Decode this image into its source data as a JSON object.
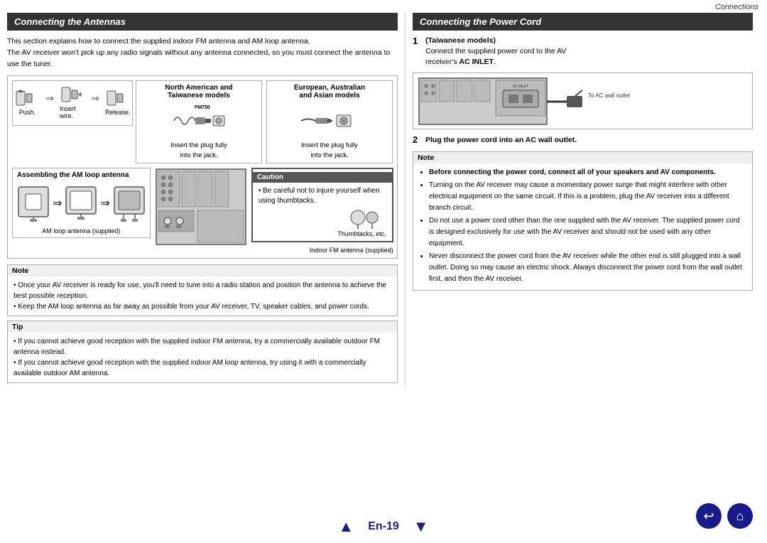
{
  "header": {
    "section_label": "Connections"
  },
  "left_section": {
    "title": "Connecting the Antennas",
    "intro_lines": [
      "This section explains how to connect the supplied indoor FM antenna and AM loop antenna.",
      "The AV receiver won't pick up any radio signals without any antenna connected, so you must connect the antenna to use the tuner."
    ],
    "fm_wire": {
      "steps": [
        "Push.",
        "Insert wire.",
        "Release."
      ]
    },
    "north_american_box": {
      "heading_line1": "North American and",
      "heading_line2": "Taiwanese models",
      "fm750_label": "FM750",
      "text_line1": "Insert the plug fully",
      "text_line2": "into the jack."
    },
    "european_box": {
      "heading_line1": "European, Australian",
      "heading_line2": "and Asian models",
      "text_line1": "Insert the plug fully",
      "text_line2": "into the jack."
    },
    "am_loop": {
      "header": "Assembling the AM loop antenna",
      "label": "AM loop antenna (supplied)"
    },
    "caution": {
      "header": "Caution",
      "bullet": "Be careful not to injure yourself when using thumbtacks.",
      "sub_label": "Thumbtacks, etc."
    },
    "fm_antenna_label": "Indoor FM antenna (supplied)",
    "note": {
      "header": "Note",
      "bullets": [
        "Once your AV receiver is ready for use, you'll need to tune into a radio station and position the antenna to achieve the best possible reception.",
        "Keep the AM loop antenna as far away as possible from your AV receiver, TV, speaker cables, and power cords."
      ]
    },
    "tip": {
      "header": "Tip",
      "bullets": [
        "If you cannot achieve good reception with the supplied indoor FM antenna, try a commercially available outdoor FM antenna instead.",
        "If you cannot achieve good reception with the supplied indoor AM loop antenna, try using it with a commercially available outdoor AM antenna."
      ]
    }
  },
  "right_section": {
    "title": "Connecting the Power Cord",
    "step1": {
      "number": "1",
      "label": "(Taiwanese models)",
      "desc_line1": "Connect the supplied power cord to the AV",
      "desc_line2": "receiver's",
      "desc_bold": "AC INLET",
      "desc_end": ".",
      "diagram_label": "To AC wall outlet"
    },
    "step2": {
      "number": "2",
      "desc": "Plug the power cord into an AC wall outlet."
    },
    "note": {
      "header": "Note",
      "bold_item": "Before connecting the power cord, connect all of your speakers and AV components.",
      "bullets": [
        "Turning on the AV receiver may cause a momentary power surge that might interfere with other electrical equipment on the same circuit. If this is a problem, plug the AV receiver into a different branch circuit.",
        "Do not use a power cord other than the one supplied with the AV receiver. The supplied power cord is designed exclusively for use with the AV receiver and should not be used with any other equipment.",
        "Never disconnect the power cord from the AV receiver while the other end is still plugged into a wall outlet. Doing so may cause an electric shock. Always disconnect the power cord from the wall outlet first, and then the AV receiver."
      ]
    }
  },
  "footer": {
    "page_label": "En-19",
    "back_icon": "↩",
    "home_icon": "⌂"
  }
}
